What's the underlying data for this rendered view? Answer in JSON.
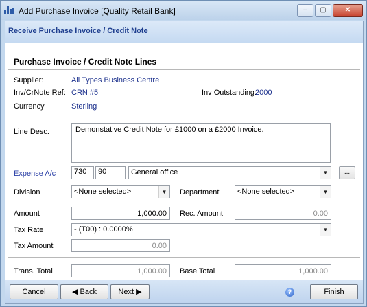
{
  "window": {
    "title": "Add Purchase Invoice [Quality Retail Bank]",
    "controls": {
      "minimize": "–",
      "maximize": "▢",
      "close": "✕"
    }
  },
  "header": {
    "title": "Receive Purchase Invoice / Credit Note"
  },
  "section_title": "Purchase Invoice / Credit Note Lines",
  "info": {
    "supplier_label": "Supplier:",
    "supplier_value": "All Types Business Centre",
    "ref_label": "Inv/CrNote Ref:",
    "ref_value": "CRN #5",
    "outstanding_label": "Inv Outstanding:",
    "outstanding_value": "2000",
    "currency_label": "Currency",
    "currency_value": "Sterling"
  },
  "form": {
    "line_desc_label": "Line Desc.",
    "line_desc_value": "Demonstative Credit Note for £1000 on a £2000 Invoice.",
    "expense_label": "Expense A/c",
    "expense_code1": "730",
    "expense_code2": "90",
    "expense_name": "General office",
    "ellipsis": "...",
    "division_label": "Division",
    "division_value": "<None selected>",
    "department_label": "Department",
    "department_value": "<None selected>",
    "amount_label": "Amount",
    "amount_value": "1,000.00",
    "rec_amount_label": "Rec. Amount",
    "rec_amount_value": "0.00",
    "tax_rate_label": "Tax Rate",
    "tax_rate_value": "- (T00) : 0.0000%",
    "tax_amount_label": "Tax Amount",
    "tax_amount_value": "0.00",
    "trans_total_label": "Trans. Total",
    "trans_total_value": "1,000.00",
    "base_total_label": "Base Total",
    "base_total_value": "1,000.00"
  },
  "footer": {
    "cancel": "Cancel",
    "back": "Back",
    "next": "Next",
    "help": "?",
    "finish": "Finish"
  },
  "icons": {
    "dropdown": "▼",
    "back_arrow": "◀",
    "next_arrow": "▶"
  },
  "colors": {
    "header_text": "#1f3f8f",
    "value_text": "#1a2f8c",
    "link": "#2a3fa6"
  }
}
